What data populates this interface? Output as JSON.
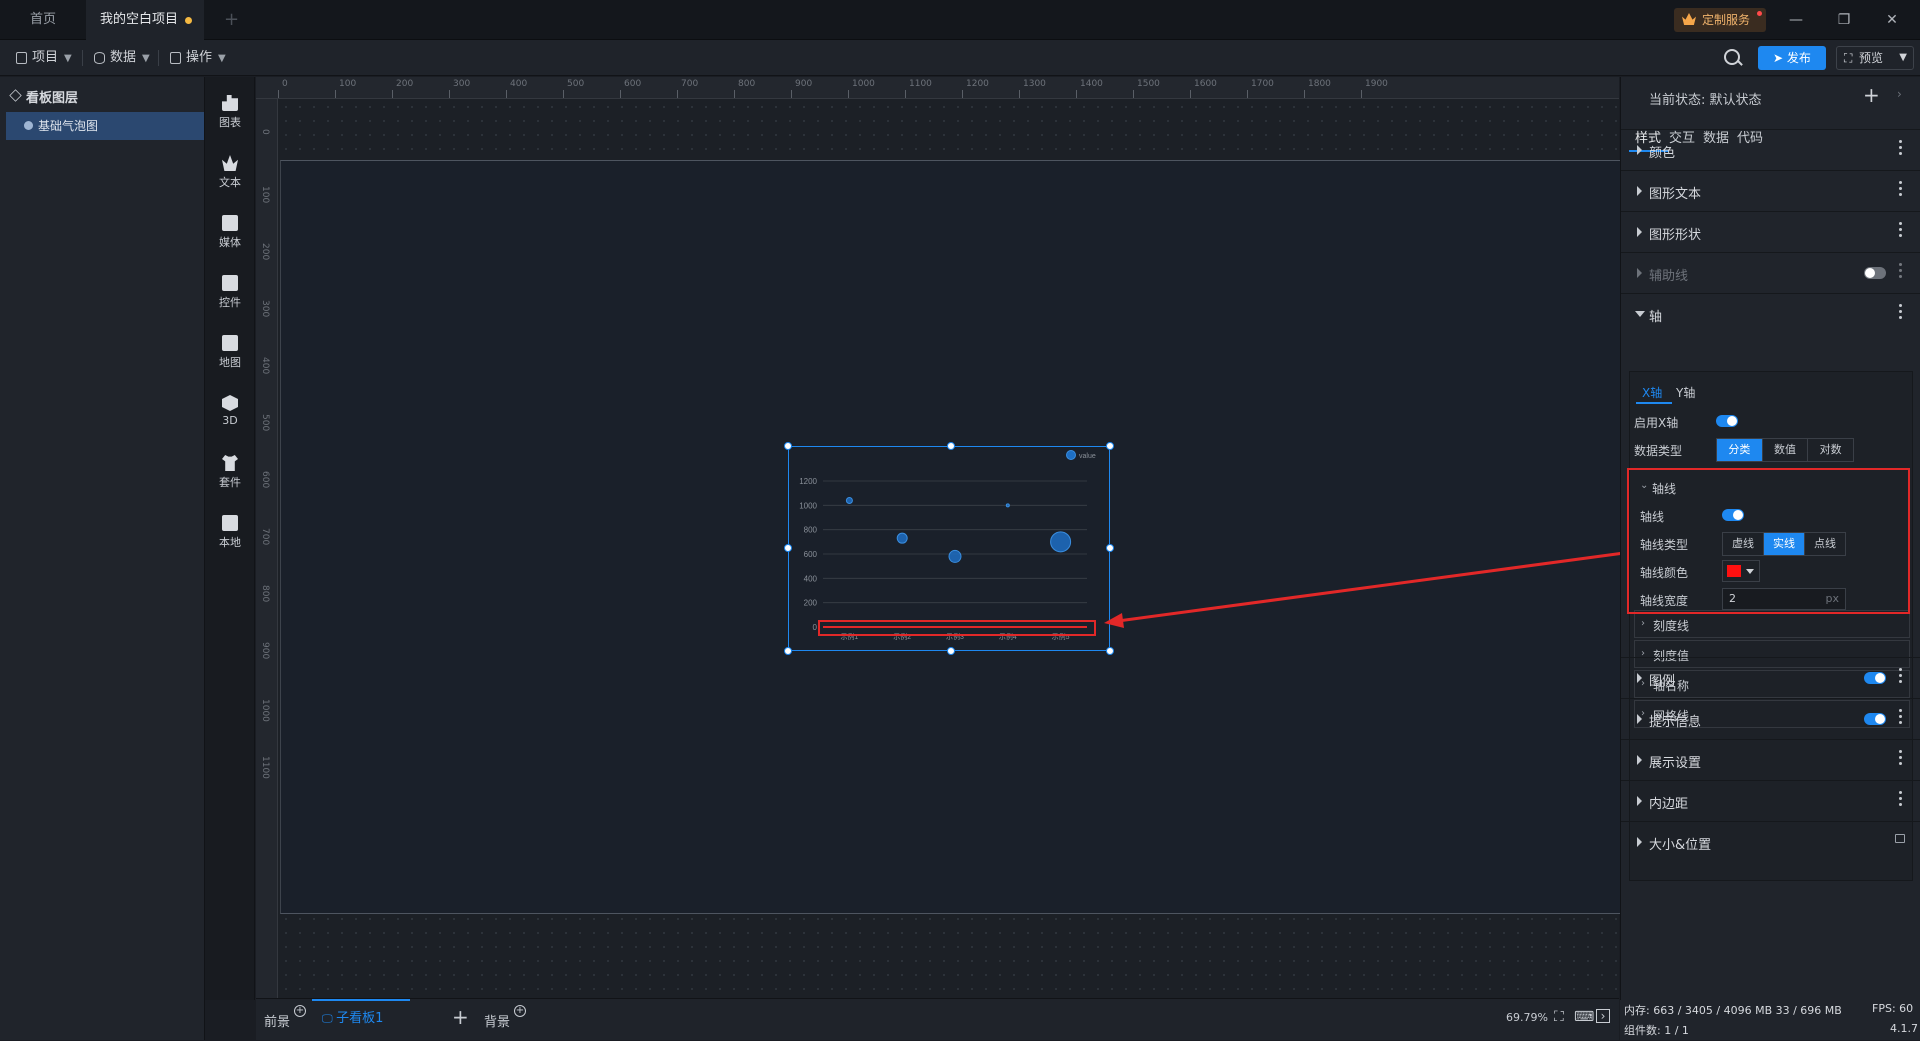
{
  "titlebar": {
    "tabs": [
      "首页",
      "我的空白项目"
    ],
    "service_button": "定制服务"
  },
  "toolbar": {
    "menus": [
      "项目",
      "数据",
      "操作"
    ],
    "publish": "发布",
    "preview": "预览"
  },
  "layers": {
    "title": "看板图层",
    "items": [
      "基础气泡图"
    ]
  },
  "components": [
    "图表",
    "文本",
    "媒体",
    "控件",
    "地图",
    "3D",
    "套件",
    "本地"
  ],
  "ruler": {
    "top": [
      "0",
      "100",
      "200",
      "300",
      "400",
      "500",
      "600",
      "700",
      "800",
      "900",
      "1000",
      "1100",
      "1200",
      "1300",
      "1400",
      "1500",
      "1600",
      "1700",
      "1800",
      "1900"
    ],
    "left": [
      "0",
      "100",
      "200",
      "300",
      "400",
      "500",
      "600",
      "700",
      "800",
      "900",
      "1000",
      "1100"
    ]
  },
  "chart_data": {
    "type": "scatter",
    "title": "",
    "legend": [
      "value"
    ],
    "legend_position": "top-right",
    "categories": [
      "示例1",
      "示例2",
      "示例3",
      "示例4",
      "示例5"
    ],
    "y_ticks": [
      "0",
      "200",
      "400",
      "600",
      "800",
      "1000",
      "1200"
    ],
    "ylim": [
      0,
      1200
    ],
    "series": [
      {
        "name": "value",
        "points": [
          {
            "x": "示例1",
            "y": 1040,
            "size": 3
          },
          {
            "x": "示例2",
            "y": 730,
            "size": 5
          },
          {
            "x": "示例3",
            "y": 580,
            "size": 6
          },
          {
            "x": "示例4",
            "y": 1000,
            "size": 1.5
          },
          {
            "x": "示例5",
            "y": 700,
            "size": 10
          }
        ]
      }
    ],
    "color": "#1e6fc4"
  },
  "bottombar": {
    "front": "前景",
    "sub_board": "子看板1",
    "background": "背景",
    "zoom": "69.79%"
  },
  "panel": {
    "state_label": "当前状态:  默认状态",
    "tabs": [
      "样式",
      "交互",
      "数据",
      "代码"
    ],
    "sections": [
      "颜色",
      "图形文本",
      "图形形状",
      "辅助线",
      "轴"
    ],
    "axis_tabs": [
      "X轴",
      "Y轴"
    ],
    "enable_x": "启用X轴",
    "data_type": "数据类型",
    "data_type_options": [
      "分类",
      "数值",
      "对数"
    ],
    "axis_line_group": "轴线",
    "axis_line": "轴线",
    "axis_line_type": "轴线类型",
    "axis_line_type_options": [
      "虚线",
      "实线",
      "点线"
    ],
    "axis_line_color": "轴线颜色",
    "axis_line_width": "轴线宽度",
    "axis_line_width_value": "2",
    "unit": "px",
    "sub_sections": [
      "刻度线",
      "刻度值",
      "轴名称",
      "网格线"
    ],
    "bottom_sections": [
      "图例",
      "提示信息",
      "展示设置",
      "内边距",
      "大小&位置"
    ]
  },
  "status": {
    "memory": "内存:  663 / 3405 / 4096 MB  33 / 696 MB",
    "fps": "FPS:  60",
    "components": "组件数: 1 / 1",
    "version": "4.1.7"
  }
}
